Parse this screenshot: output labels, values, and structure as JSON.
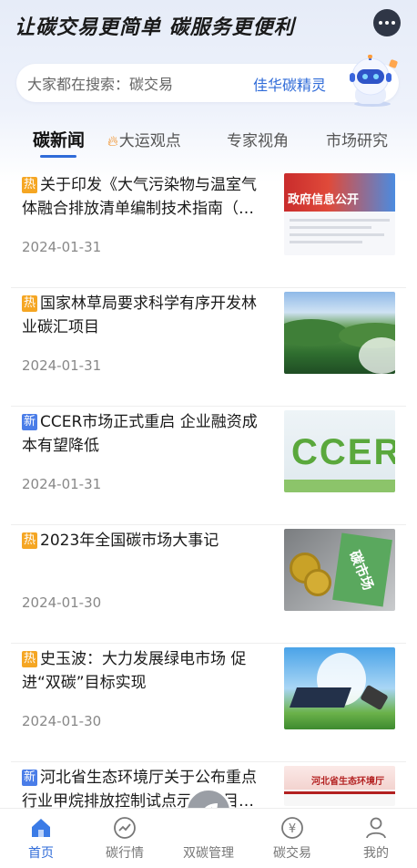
{
  "header": {
    "slogan": "让碳交易更简单 碳服务更便利"
  },
  "search": {
    "prefix": "大家都在搜索：",
    "term": "碳交易",
    "assistant_label": "佳华碳精灵"
  },
  "tabs": [
    {
      "label": "碳新闻",
      "active": true
    },
    {
      "label": "大运观点",
      "icon": "fire-icon"
    },
    {
      "label": "专家视角"
    },
    {
      "label": "市场研究"
    }
  ],
  "news": [
    {
      "badge": "热",
      "badge_type": "hot",
      "title": "关于印发《大气污染物与温室气体融合排放清单编制技术指南（试行）》的通知",
      "date": "2024-01-31",
      "thumb_text": "政府信息公开"
    },
    {
      "badge": "热",
      "badge_type": "hot",
      "title": "国家林草局要求科学有序开发林业碳汇项目",
      "date": "2024-01-31"
    },
    {
      "badge": "新",
      "badge_type": "new",
      "title": "CCER市场正式重启 企业融资成本有望降低",
      "date": "2024-01-31",
      "thumb_text": "CCER"
    },
    {
      "badge": "热",
      "badge_type": "hot",
      "title": "2023年全国碳市场大事记",
      "date": "2024-01-30",
      "thumb_text": "碳市场"
    },
    {
      "badge": "热",
      "badge_type": "hot",
      "title": "史玉波：大力发展绿电市场 促进“双碳”目标实现",
      "date": "2024-01-30"
    },
    {
      "badge": "新",
      "badge_type": "new",
      "title": "河北省生态环境厅关于公布重点行业甲烷排放控制试点示范项目的通知",
      "date": "",
      "thumb_text": "河北省生态环境厅"
    }
  ],
  "bottom_nav": [
    {
      "label": "首页",
      "icon": "home-icon",
      "active": true
    },
    {
      "label": "碳行情",
      "icon": "trend-icon"
    },
    {
      "label": "双碳管理",
      "icon": "leaf-icon"
    },
    {
      "label": "碳交易",
      "icon": "yuan-icon"
    },
    {
      "label": "我的",
      "icon": "user-icon"
    }
  ],
  "colors": {
    "accent": "#2f6bd8",
    "hot_badge": "#f5a623",
    "new_badge": "#4a7de8"
  }
}
